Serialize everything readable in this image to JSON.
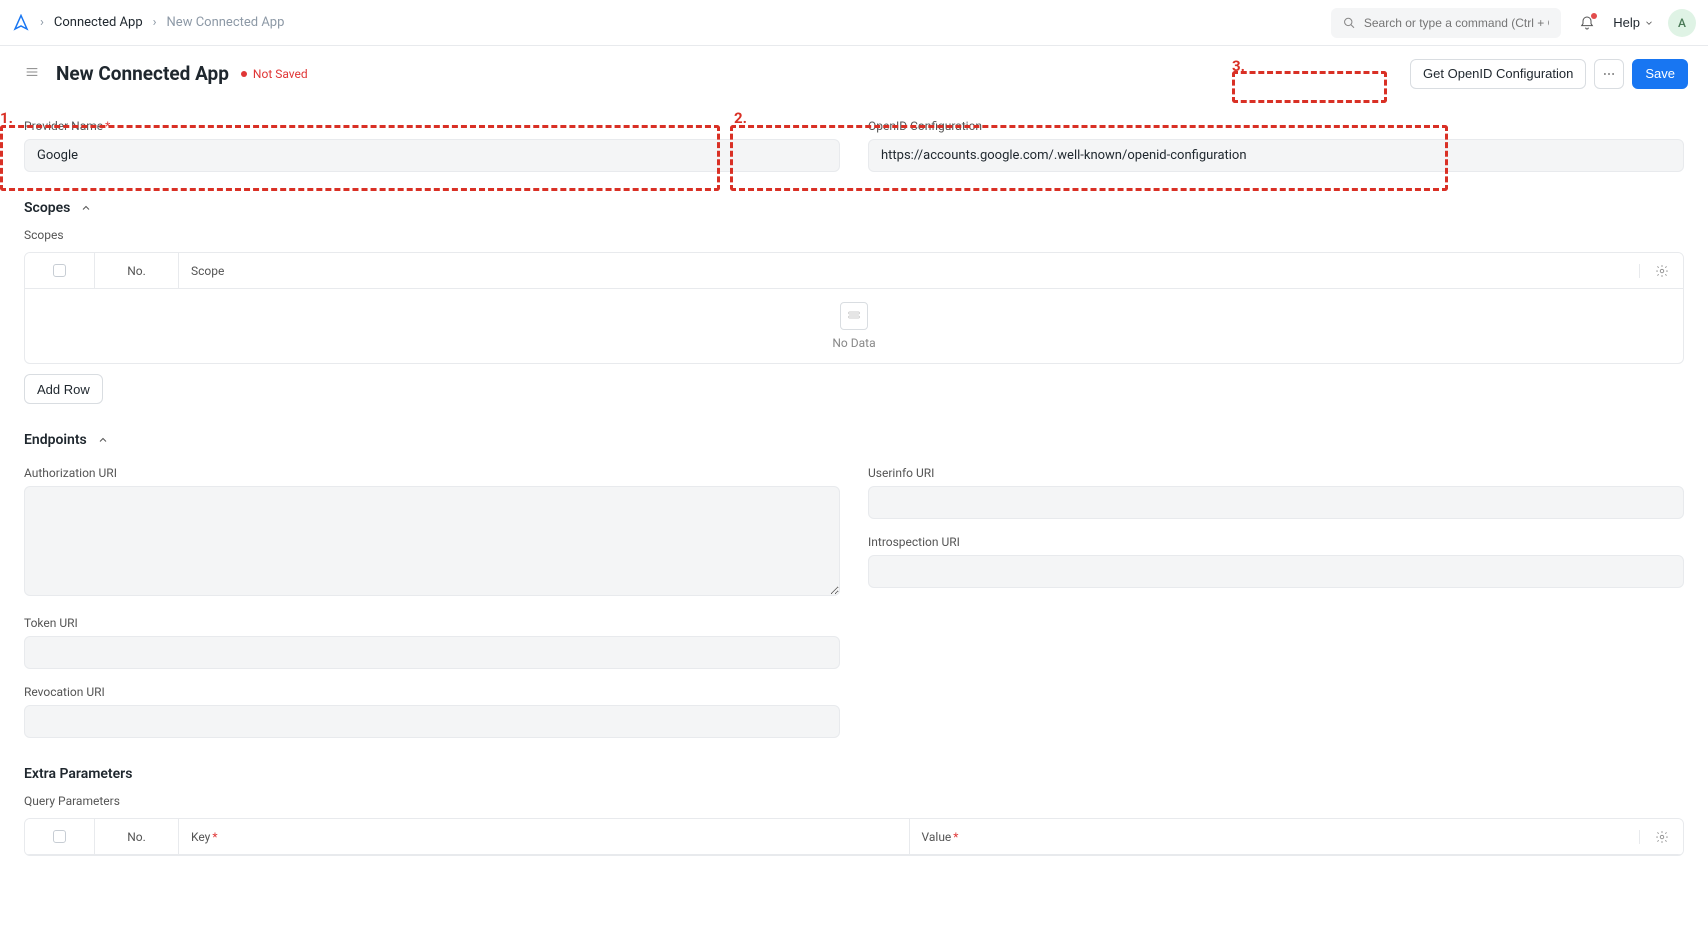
{
  "topbar": {
    "breadcrumb": [
      "Connected App",
      "New Connected App"
    ],
    "search_placeholder": "Search or type a command (Ctrl + G)",
    "help_label": "Help",
    "avatar_letter": "A"
  },
  "header": {
    "title": "New Connected App",
    "status": "Not Saved",
    "get_openid_label": "Get OpenID Configuration",
    "save_label": "Save"
  },
  "form": {
    "provider_name_label": "Provider Name",
    "provider_name_value": "Google",
    "openid_config_label": "OpenID Configuration",
    "openid_config_value": "https://accounts.google.com/.well-known/openid-configuration"
  },
  "scopes": {
    "section_label": "Scopes",
    "table_label": "Scopes",
    "columns": {
      "no": "No.",
      "scope": "Scope"
    },
    "no_data": "No Data",
    "add_row": "Add Row"
  },
  "endpoints": {
    "section_label": "Endpoints",
    "authorization_uri_label": "Authorization URI",
    "token_uri_label": "Token URI",
    "revocation_uri_label": "Revocation URI",
    "userinfo_uri_label": "Userinfo URI",
    "introspection_uri_label": "Introspection URI"
  },
  "extra": {
    "section_label": "Extra Parameters",
    "query_params_label": "Query Parameters",
    "columns": {
      "no": "No.",
      "key": "Key",
      "value": "Value"
    }
  },
  "annotations": {
    "n1": "1.",
    "n2": "2.",
    "n3": "3."
  }
}
